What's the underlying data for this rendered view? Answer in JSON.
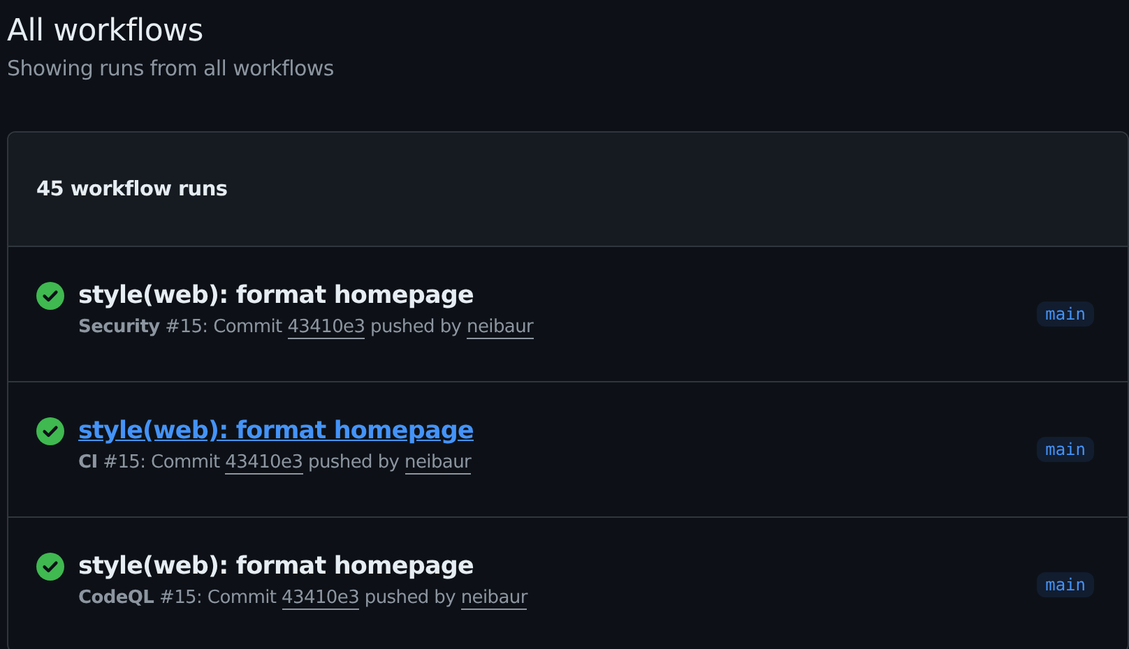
{
  "page": {
    "title": "All workflows",
    "subtitle": "Showing runs from all workflows"
  },
  "runs_box": {
    "count_label": "45 workflow runs",
    "runs": [
      {
        "succeeded": true,
        "title": "style(web): format homepage",
        "hovered": false,
        "workflow": "Security",
        "run_text": "#15: Commit",
        "commit": "43410e3",
        "pushed_text": "pushed by",
        "user": "neibaur",
        "branch": "main"
      },
      {
        "succeeded": true,
        "title": "style(web): format homepage",
        "hovered": true,
        "workflow": "CI",
        "run_text": "#15: Commit",
        "commit": "43410e3",
        "pushed_text": "pushed by",
        "user": "neibaur",
        "branch": "main"
      },
      {
        "succeeded": true,
        "title": "style(web): format homepage",
        "hovered": false,
        "workflow": "CodeQL",
        "run_text": "#15: Commit",
        "commit": "43410e3",
        "pushed_text": "pushed by",
        "user": "neibaur",
        "branch": "main"
      }
    ]
  }
}
